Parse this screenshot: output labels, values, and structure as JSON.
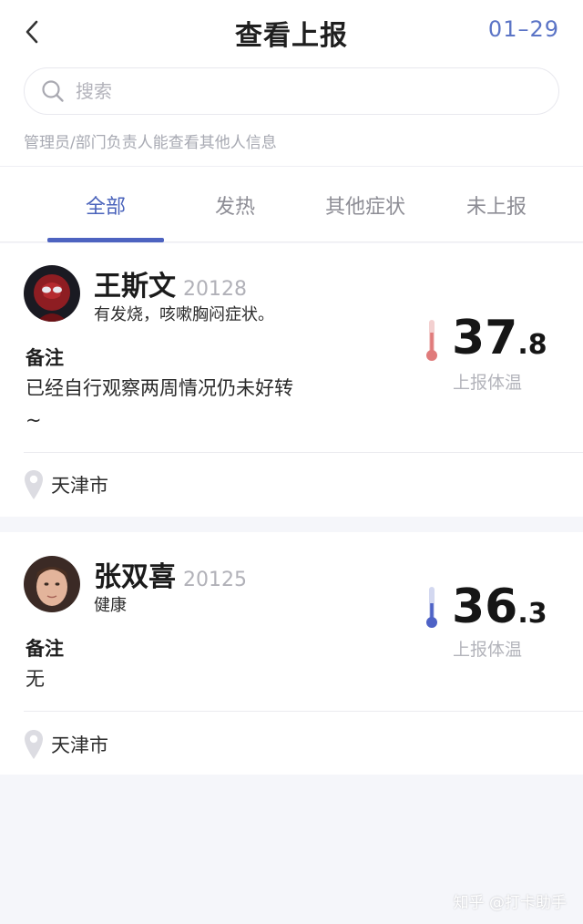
{
  "header": {
    "title": "查看上报",
    "date": "01–29"
  },
  "search": {
    "placeholder": "搜索",
    "hint": "管理员/部门负责人能查看其他人信息"
  },
  "tabs": [
    {
      "label": "全部",
      "active": true
    },
    {
      "label": "发热",
      "active": false
    },
    {
      "label": "其他症状",
      "active": false
    },
    {
      "label": "未上报",
      "active": false
    }
  ],
  "reports": [
    {
      "name": "王斯文",
      "id": "20128",
      "status": "有发烧，咳嗽胸闷症状。",
      "note_label": "备注",
      "note": "已经自行观察两周情况仍未好转~",
      "temp_int": "37",
      "temp_dec": ".8",
      "temp_label": "上报体温",
      "location": "天津市",
      "thermo_color": "#e07b7b"
    },
    {
      "name": "张双喜",
      "id": "20125",
      "status": "健康",
      "note_label": "备注",
      "note": "无",
      "temp_int": "36",
      "temp_dec": ".3",
      "temp_label": "上报体温",
      "location": "天津市",
      "thermo_color": "#4e62c6"
    }
  ],
  "watermark": "知乎 @打卡助手",
  "colors": {
    "accent": "#4a63bb",
    "fever": "#e07b7b",
    "normal": "#4e62c6"
  }
}
